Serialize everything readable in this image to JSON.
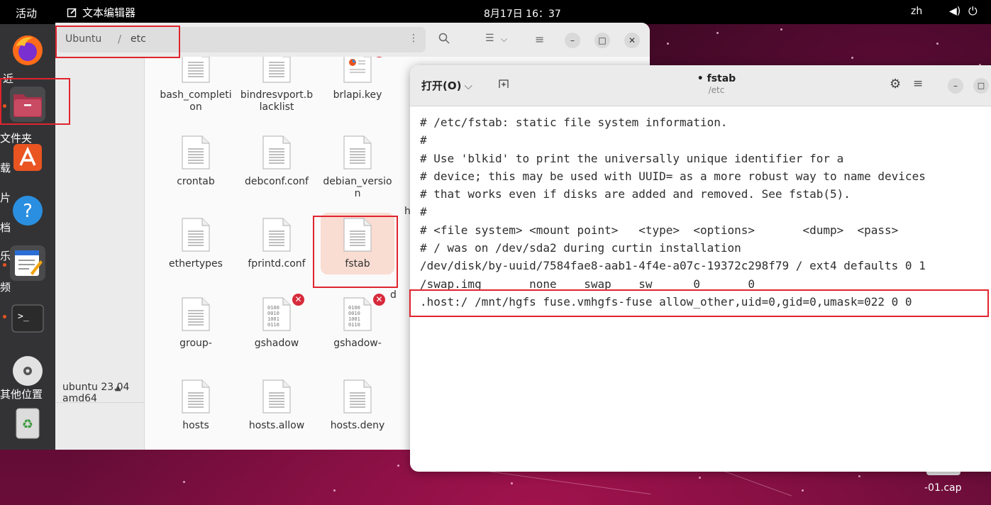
{
  "topbar": {
    "activities": "活动",
    "app_name": "文本编辑器",
    "clock": "8月17日 16：37",
    "lang": "zh"
  },
  "dock": {
    "apps": [
      {
        "name": "Firefox",
        "icon": "firefox-icon"
      },
      {
        "name": "Files",
        "icon": "files-icon"
      },
      {
        "name": "App Center",
        "icon": "app-center-icon"
      },
      {
        "name": "Help",
        "icon": "help-icon"
      },
      {
        "name": "Text Editor",
        "icon": "text-editor-icon"
      },
      {
        "name": "Terminal",
        "icon": "terminal-icon"
      },
      {
        "name": "Disc",
        "icon": "disc-icon"
      },
      {
        "name": "Trash",
        "icon": "trash-icon"
      }
    ],
    "overlay_fragments": [
      "近",
      "文件夹",
      "载",
      "片",
      "档",
      "乐",
      "频",
      "其他位置"
    ]
  },
  "file_manager": {
    "path": {
      "root": "Ubuntu",
      "separator": "/",
      "current": "etc"
    },
    "sidebar": {
      "device": "ubuntu 23.04 amd64"
    },
    "files": [
      {
        "name": "bash_completion",
        "type": "text"
      },
      {
        "name": "bindresvport.blacklist",
        "type": "text"
      },
      {
        "name": "brlapi.key",
        "type": "key",
        "locked": true
      },
      {
        "name": "crontab",
        "type": "text"
      },
      {
        "name": "debconf.conf",
        "type": "text"
      },
      {
        "name": "debian_version",
        "type": "text"
      },
      {
        "name": "ethertypes",
        "type": "text"
      },
      {
        "name": "fprintd.conf",
        "type": "text"
      },
      {
        "name": "fstab",
        "type": "text",
        "selected": true
      },
      {
        "name": "group-",
        "type": "text"
      },
      {
        "name": "gshadow",
        "type": "binary",
        "locked": true
      },
      {
        "name": "gshadow-",
        "type": "binary",
        "locked": true
      },
      {
        "name": "hosts",
        "type": "text"
      },
      {
        "name": "hosts.allow",
        "type": "text"
      },
      {
        "name": "hosts.deny",
        "type": "text"
      }
    ],
    "cut_letters": [
      "d",
      "h"
    ]
  },
  "editor": {
    "open_label": "打开(O)",
    "title": "• fstab",
    "subtitle": "/etc",
    "lines": [
      "# /etc/fstab: static file system information.",
      "#",
      "# Use 'blkid' to print the universally unique identifier for a",
      "# device; this may be used with UUID= as a more robust way to name devices",
      "# that works even if disks are added and removed. See fstab(5).",
      "#",
      "# <file system> <mount point>   <type>  <options>       <dump>  <pass>",
      "# / was on /dev/sda2 during curtin installation",
      "/dev/disk/by-uuid/7584fae8-aab1-4f4e-a07c-19372c298f79 / ext4 defaults 0 1",
      "/swap.img       none    swap    sw      0       0",
      ".host:/ /mnt/hgfs fuse.vmhgfs-fuse allow_other,uid=0,gid=0,umask=022 0 0"
    ]
  },
  "desktop": {
    "file_label": "-01.cap"
  }
}
